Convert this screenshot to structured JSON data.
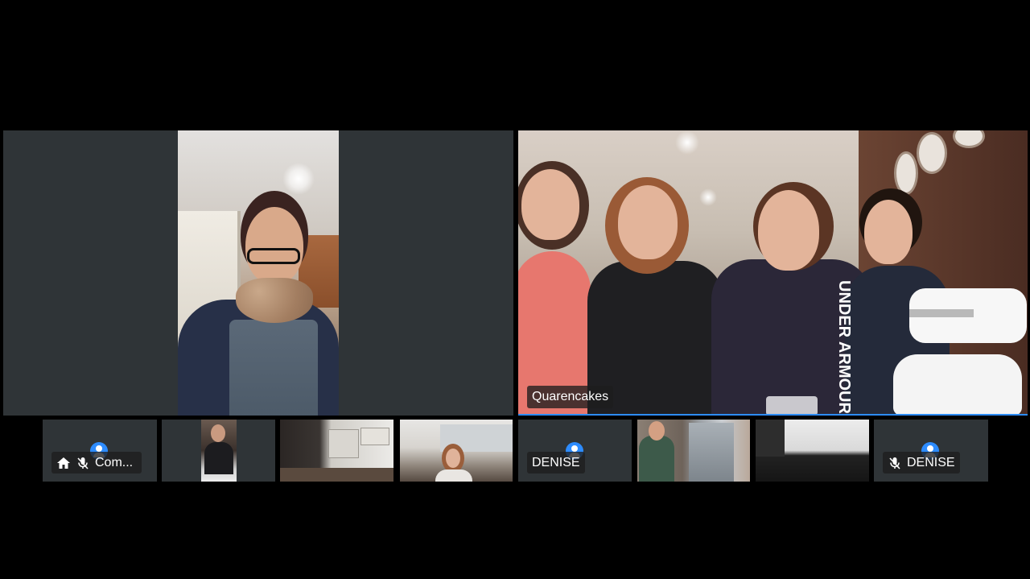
{
  "meeting": {
    "main_tiles": [
      {
        "name": ""
      },
      {
        "name": "Quarencakes"
      }
    ],
    "thumbnails": [
      {
        "name": "Com...",
        "muted": true,
        "host": true,
        "video": false
      },
      {
        "name": "",
        "video": true
      },
      {
        "name": "",
        "video": true
      },
      {
        "name": "",
        "video": true
      },
      {
        "name": "DENISE",
        "muted": false,
        "video": false
      },
      {
        "name": "",
        "video": true
      },
      {
        "name": "",
        "video": true
      },
      {
        "name": "DENISE",
        "muted": true,
        "video": false
      }
    ]
  },
  "colors": {
    "background": "#000000",
    "tile": "#2f3437",
    "active_speaker_border": "#2d8cff",
    "avatar": "#2d8cff"
  },
  "icons": {
    "home": "home-icon",
    "mic_muted": "microphone-muted-icon",
    "avatar": "user-avatar-icon"
  }
}
